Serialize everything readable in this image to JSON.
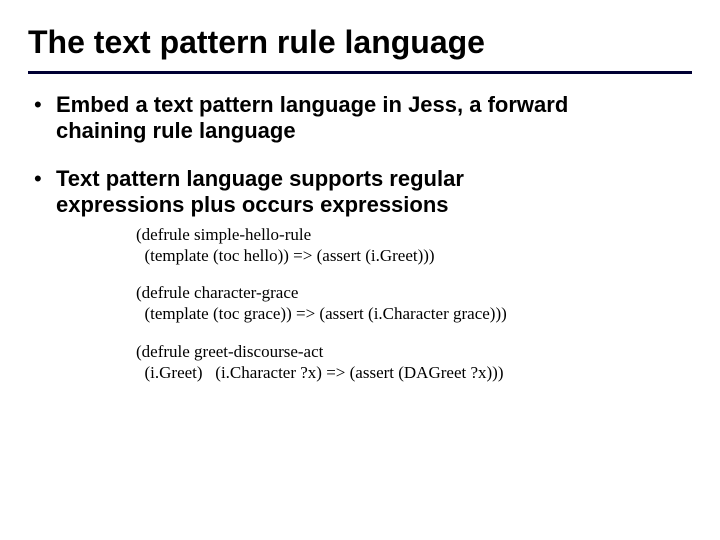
{
  "title": "The text pattern rule language",
  "bullets": {
    "b1": {
      "bold": "Embed a text pattern language in Jess, a forward",
      "rest": "chaining rule language"
    },
    "b2": {
      "bold": "Text pattern language supports regular",
      "rest": "expressions plus occurs expressions"
    }
  },
  "code": {
    "c1": "(defrule simple-hello-rule\n  (template (toc hello)) => (assert (i.Greet)))",
    "c2": "(defrule character-grace\n  (template (toc grace)) => (assert (i.Character grace)))",
    "c3": "(defrule greet-discourse-act\n  (i.Greet)   (i.Character ?x) => (assert (DAGreet ?x)))"
  }
}
